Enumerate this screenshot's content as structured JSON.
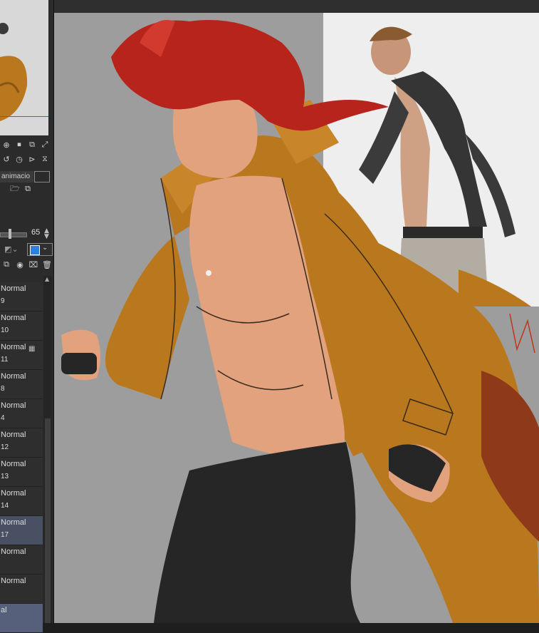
{
  "navigator": {},
  "panel": {
    "animation_tab": "animacio",
    "opacity": "65"
  },
  "layers": [
    {
      "mode": "Normal",
      "name": "9"
    },
    {
      "mode": "Normal",
      "name": "10"
    },
    {
      "mode": "Normal",
      "name": "11"
    },
    {
      "mode": "Normal",
      "name": "8"
    },
    {
      "mode": "Normal",
      "name": "4"
    },
    {
      "mode": "Normal",
      "name": "12"
    },
    {
      "mode": "Normal",
      "name": "13"
    },
    {
      "mode": "Normal",
      "name": "14"
    },
    {
      "mode": "Normal",
      "name": "17"
    },
    {
      "mode": "Normal",
      "name": ""
    },
    {
      "mode": "Normal",
      "name": ""
    },
    {
      "mode": "al",
      "name": ""
    }
  ],
  "colors": {
    "hair": "#b7241b",
    "coat": "#b9781e",
    "skin": "#e3a27e",
    "pants": "#262626"
  }
}
